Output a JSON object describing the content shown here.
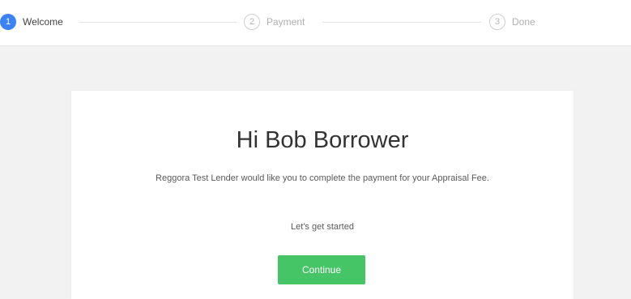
{
  "stepper": {
    "steps": [
      {
        "number": "1",
        "label": "Welcome",
        "state": "active"
      },
      {
        "number": "2",
        "label": "Payment",
        "state": "inactive"
      },
      {
        "number": "3",
        "label": "Done",
        "state": "inactive"
      }
    ]
  },
  "main": {
    "greeting": "Hi Bob Borrower",
    "message": "Reggora Test Lender would like you to complete the payment for your Appraisal Fee.",
    "started": "Let's get started",
    "continue_label": "Continue"
  },
  "colors": {
    "accent": "#3b82f6",
    "button": "#45c565",
    "background": "#f2f2f2"
  }
}
